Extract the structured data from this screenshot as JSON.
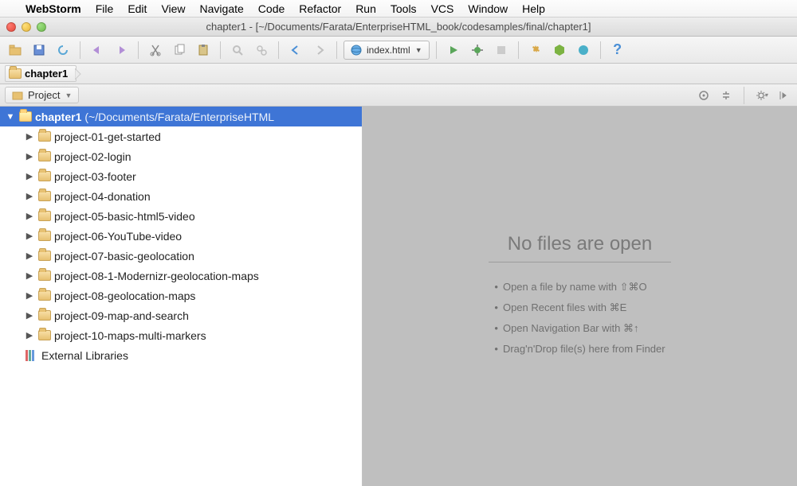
{
  "menubar": {
    "app": "WebStorm",
    "items": [
      "File",
      "Edit",
      "View",
      "Navigate",
      "Code",
      "Refactor",
      "Run",
      "Tools",
      "VCS",
      "Window",
      "Help"
    ]
  },
  "window": {
    "title": "chapter1 - [~/Documents/Farata/EnterpriseHTML_book/codesamples/final/chapter1]"
  },
  "toolbar": {
    "run_config": "index.html"
  },
  "breadcrumb": {
    "root": "chapter1"
  },
  "project_panel": {
    "title": "Project"
  },
  "tree": {
    "root_name": "chapter1",
    "root_path": "(~/Documents/Farata/EnterpriseHTML",
    "folders": [
      "project-01-get-started",
      "project-02-login",
      "project-03-footer",
      "project-04-donation",
      "project-05-basic-html5-video",
      "project-06-YouTube-video",
      "project-07-basic-geolocation",
      "project-08-1-Modernizr-geolocation-maps",
      "project-08-geolocation-maps",
      "project-09-map-and-search",
      "project-10-maps-multi-markers"
    ],
    "external_libs": "External Libraries"
  },
  "editor": {
    "headline": "No files are open",
    "tips": [
      "Open a file by name with ⇧⌘O",
      "Open Recent files with ⌘E",
      "Open Navigation Bar with ⌘↑",
      "Drag'n'Drop file(s) here from Finder"
    ]
  }
}
